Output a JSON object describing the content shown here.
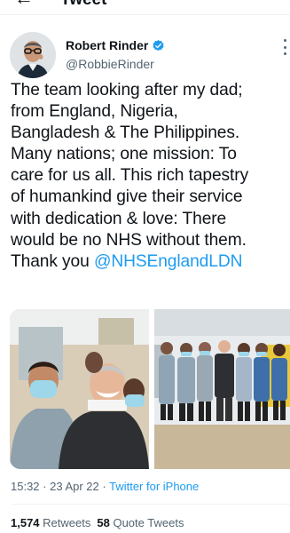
{
  "header": {
    "title": "Tweet",
    "back_icon": "arrow-left-icon"
  },
  "author": {
    "name": "Robert Rinder",
    "handle": "@RobbieRinder",
    "verified": true
  },
  "tweet": {
    "lines": [
      "The team looking after my dad;",
      "from England, Nigeria,",
      "Bangladesh & The Philippines.",
      "Many nations; one mission: To",
      "care for us all. This rich tapestry",
      "of humankind give their service",
      "with dedication & love: There",
      "would be no NHS without them."
    ],
    "last_line_text": "Thank you ",
    "mention": "@NHSEnglandLDN"
  },
  "meta": {
    "time": "15:32",
    "separator": " · ",
    "date": "23 Apr 22",
    "source": "Twitter for iPhone"
  },
  "stats": {
    "retweets_count": "1,574",
    "retweets_label": "Retweets",
    "quotes_count": "58",
    "quotes_label": "Quote Tweets"
  },
  "colors": {
    "link": "#1d9bf0",
    "secondary_text": "#536471",
    "verified_badge": "#1d9bf0"
  }
}
